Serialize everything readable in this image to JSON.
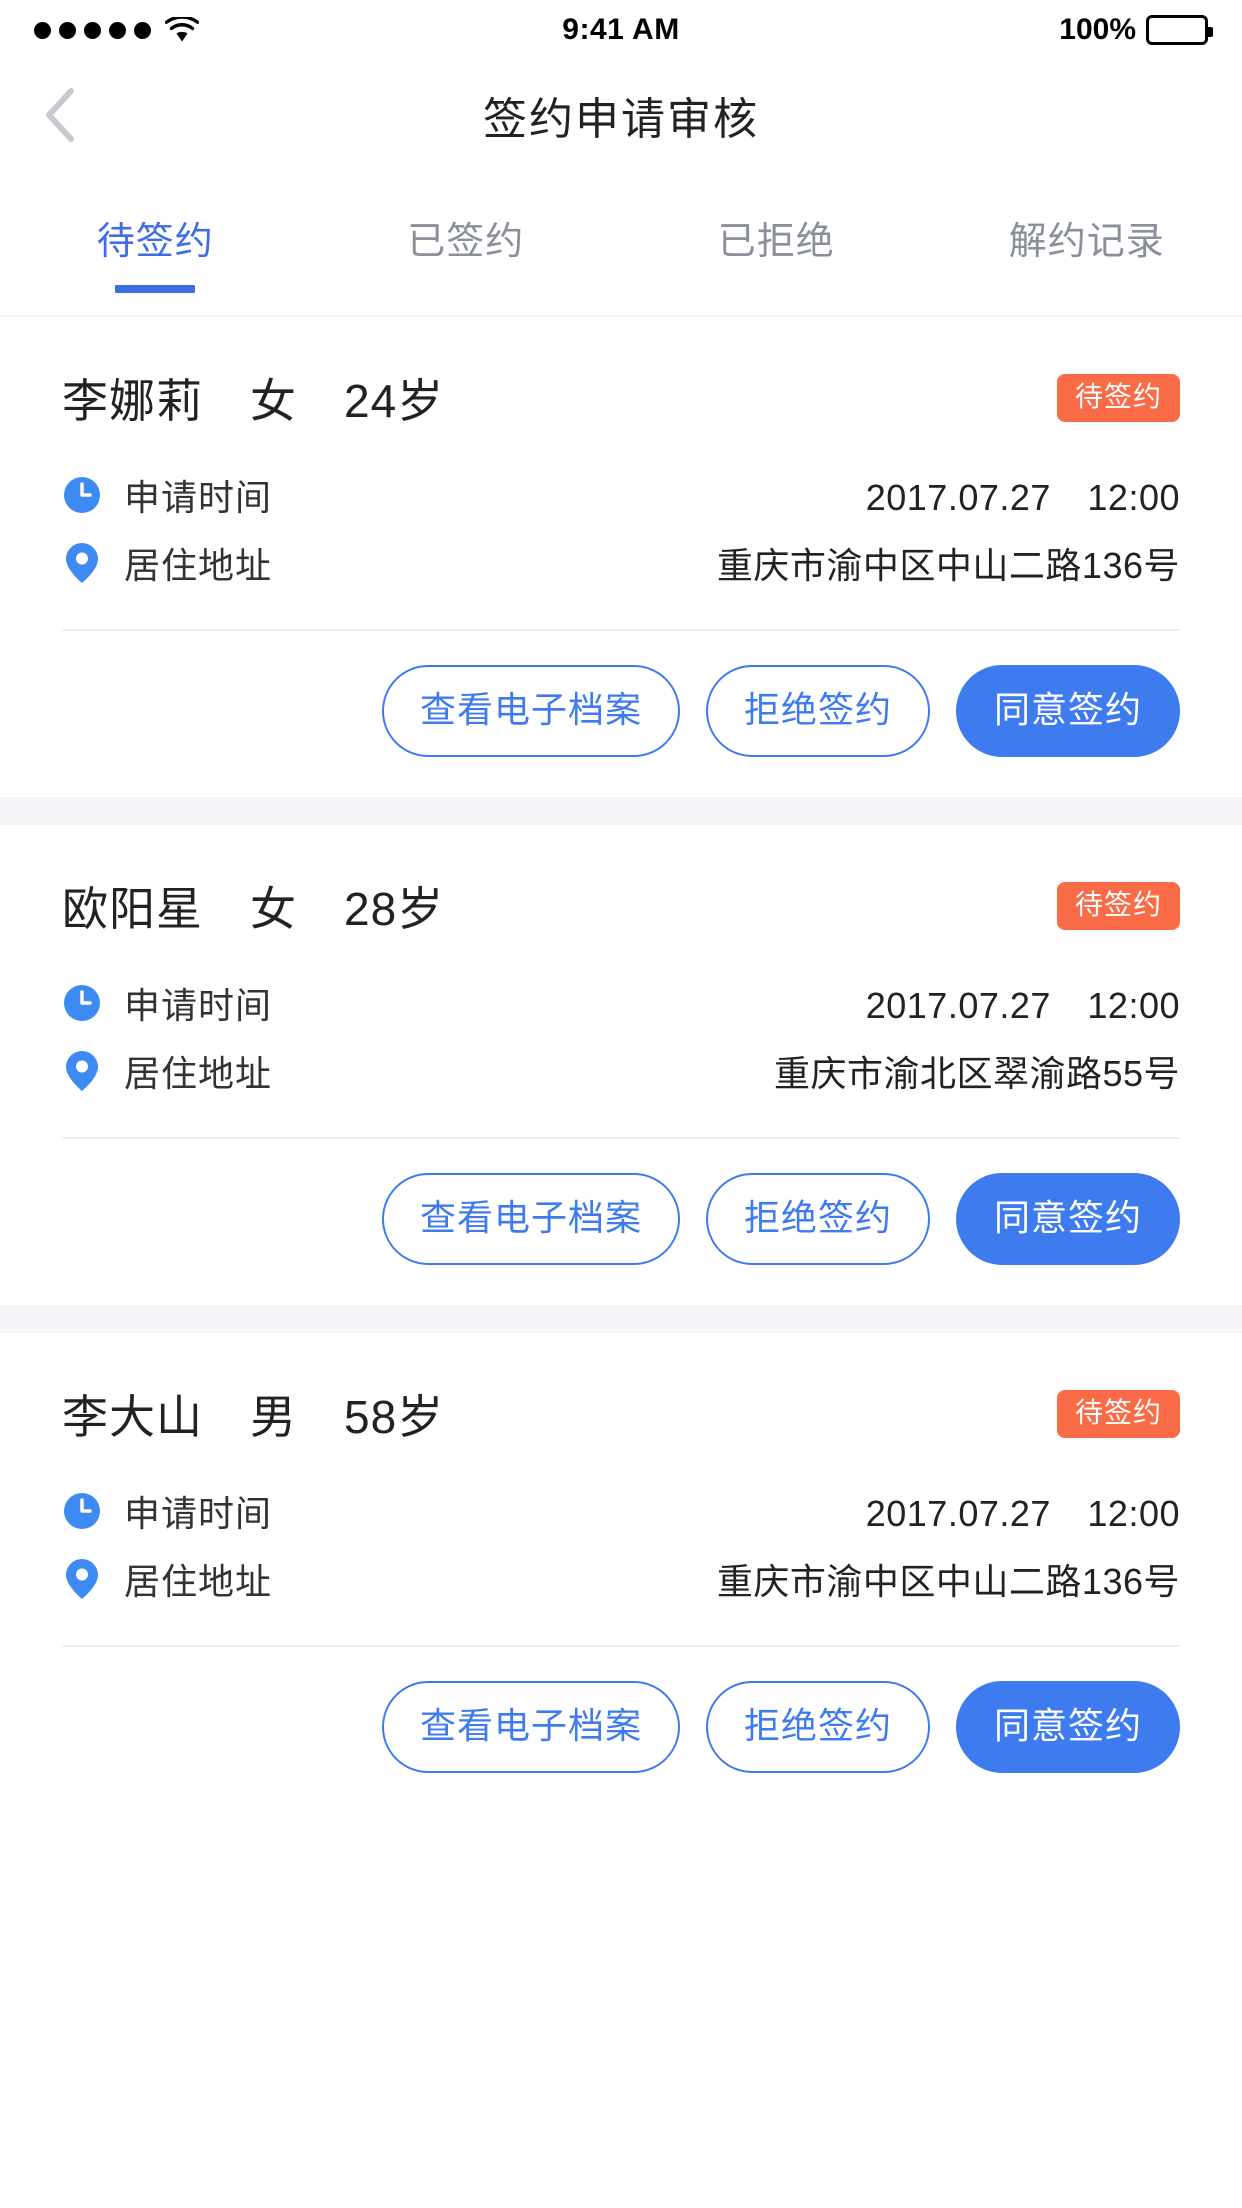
{
  "status_bar": {
    "time": "9:41 AM",
    "battery_percent": "100%",
    "signal_dots": 5,
    "wifi_icon": "wifi-icon",
    "battery_icon": "battery-icon"
  },
  "nav": {
    "back_icon": "chevron-left-icon",
    "title": "签约申请审核"
  },
  "tabs": [
    {
      "label": "待签约",
      "active": true
    },
    {
      "label": "已签约",
      "active": false
    },
    {
      "label": "已拒绝",
      "active": false
    },
    {
      "label": "解约记录",
      "active": false
    }
  ],
  "labels": {
    "apply_time": "申请时间",
    "address": "居住地址",
    "time_icon": "clock-icon",
    "address_icon": "location-pin-icon"
  },
  "buttons": {
    "view_archive": "查看电子档案",
    "reject": "拒绝签约",
    "approve": "同意签约"
  },
  "colors": {
    "primary": "#3d7bef",
    "tab_active": "#3d6ee8",
    "badge": "#fa6b47",
    "page_bg": "#f4f5f9"
  },
  "cards": [
    {
      "name": "李娜莉",
      "gender": "女",
      "age": "24岁",
      "name_line": "李娜莉　女　24岁",
      "badge": "待签约",
      "apply_time": "2017.07.27　12:00",
      "address": "重庆市渝中区中山二路136号"
    },
    {
      "name": "欧阳星",
      "gender": "女",
      "age": "28岁",
      "name_line": "欧阳星　女　28岁",
      "badge": "待签约",
      "apply_time": "2017.07.27　12:00",
      "address": "重庆市渝北区翠渝路55号"
    },
    {
      "name": "李大山",
      "gender": "男",
      "age": "58岁",
      "name_line": "李大山　男　58岁",
      "badge": "待签约",
      "apply_time": "2017.07.27　12:00",
      "address": "重庆市渝中区中山二路136号"
    }
  ]
}
